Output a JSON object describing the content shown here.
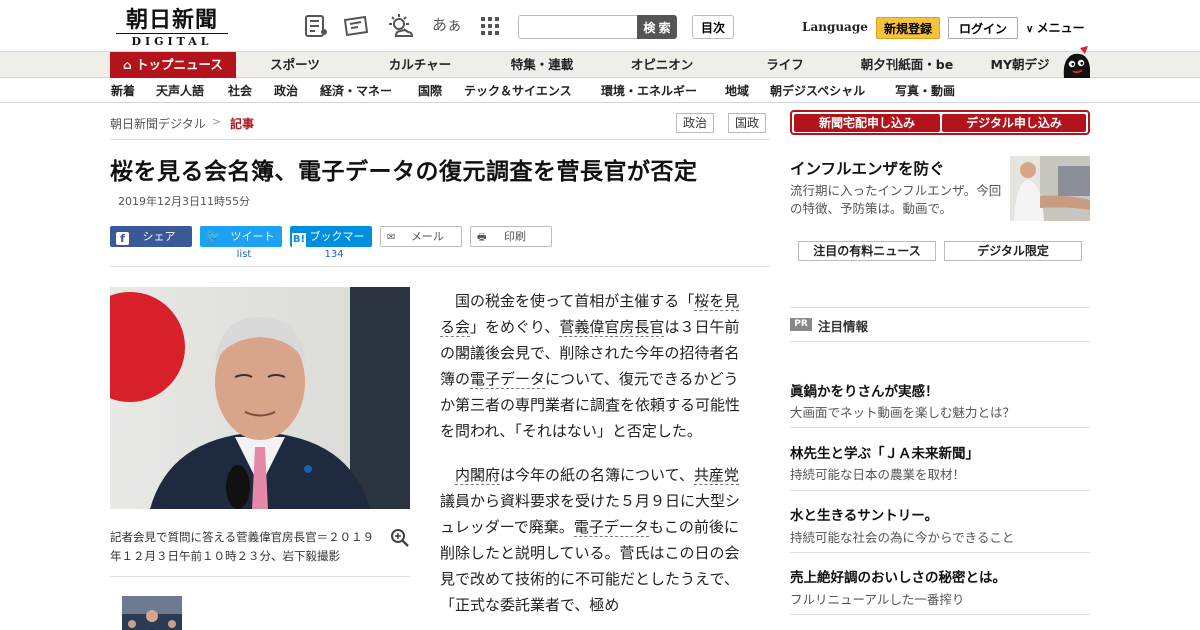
{
  "header": {
    "logo_main": "朝日新聞",
    "logo_sub": "DIGITAL",
    "font_icon_label": "あぁ",
    "search_placeholder": "",
    "search_button": "検 索",
    "toc_button": "目次",
    "language": "Language",
    "register": "新規登録",
    "login": "ログイン",
    "menu": "メニュー"
  },
  "nav1": [
    "トップニュース",
    "スポーツ",
    "カルチャー",
    "特集・連載",
    "オピニオン",
    "ライフ",
    "朝夕刊紙面・be",
    "MY朝デジ"
  ],
  "nav2": [
    "新着",
    "天声人語",
    "社会",
    "政治",
    "経済・マネー",
    "国際",
    "テック＆サイエンス",
    "環境・エネルギー",
    "地域",
    "朝デジスペシャル",
    "写真・動画"
  ],
  "breadcrumb": {
    "home": "朝日新聞デジタル",
    "sep": ">",
    "current": "記事"
  },
  "tags": [
    "政治",
    "国政"
  ],
  "article": {
    "headline": "桜を見る会名簿、電子データの復元調査を菅長官が否定",
    "date": "2019年12月3日11時55分",
    "share": {
      "facebook": "シェア",
      "twitter": "ツイート",
      "twitter_count": "list",
      "hatena": "ブックマーク",
      "hatena_count": "134",
      "mail": "メール",
      "print": "印刷"
    },
    "caption": "記者会見で質問に答える菅義偉官房長官＝２０１９年１２月３日午前１０時２３分、岩下毅撮影",
    "p1": [
      "国の税金を使って首相が主催する「",
      "桜を見る会",
      "」をめぐり、",
      "菅義偉官房長官",
      "は３日午前の閣議後会見で、削除された今年の招待者名簿の",
      "電子データ",
      "について、復元できるかどうか第三者の専門業者に調査を依頼する可能性を問われ、「それはない」と否定した。"
    ],
    "p2": [
      "内閣府",
      "は今年の紙の名簿について、",
      "共産党",
      "議員から資料要求を受けた５月９日に大型シュレッダーで廃棄。",
      "電子データ",
      "もこの前後に削除したと説明している。菅氏はこの日の会見で改めて技術的に不可能だとしたうえで、「正式な委託業者で、極め"
    ]
  },
  "sidebar": {
    "subscribe_paper": "新聞宅配申し込み",
    "subscribe_digital": "デジタル申し込み",
    "promo_title": "インフルエンザを防ぐ",
    "promo_text": "流行期に入ったインフルエンザ。今回の特徴、予防策は。動画で。",
    "tab_paid": "注目の有料ニュース",
    "tab_digital": "デジタル限定",
    "pr_badge": "PR",
    "pr_title": "注目情報",
    "ads": [
      {
        "title": "眞鍋かをりさんが実感！",
        "text": "大画面でネット動画を楽しむ魅力とは？"
      },
      {
        "title": "林先生と学ぶ「ＪＡ未来新聞」",
        "text": "持続可能な日本の農業を取材！"
      },
      {
        "title": "水と生きるサントリー。",
        "text": "持続可能な社会の為に今からできること"
      },
      {
        "title": "売上絶好調のおいしさの秘密とは。",
        "text": "フルリニューアルした一番搾り"
      }
    ]
  },
  "colors": {
    "brand_red": "#b3141b",
    "register_yellow": "#f5c23a",
    "facebook": "#3b5998",
    "twitter": "#1da1f2",
    "hatena": "#008fde"
  }
}
